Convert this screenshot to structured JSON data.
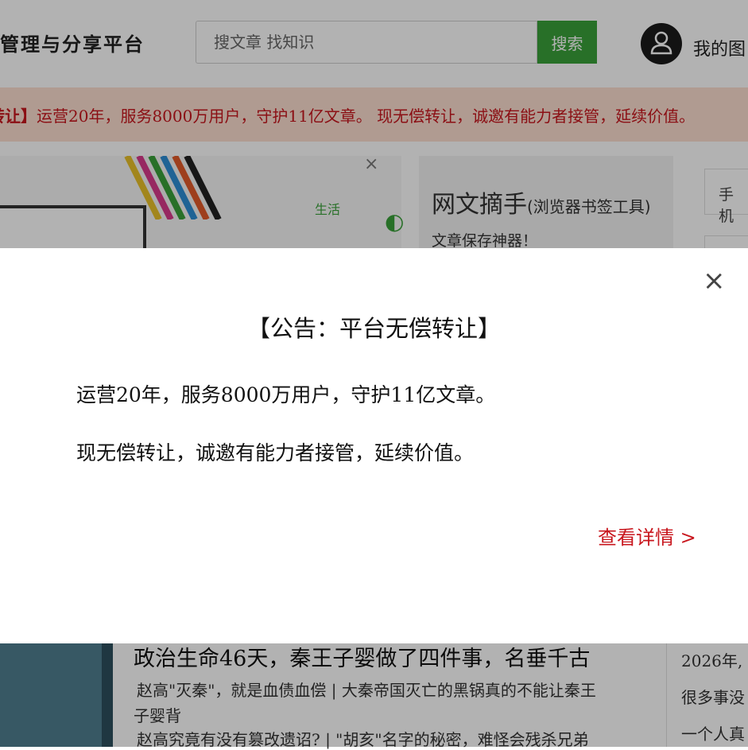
{
  "header": {
    "site_title": "管理与分享平台",
    "search_placeholder": "搜文章  找知识",
    "search_button": "搜索",
    "my_library": "我的图"
  },
  "banner": {
    "bold": "转让】",
    "text": "运营20年，服务8000万用户，守护11亿文章。 现无偿转让，诚邀有能力者接管，延续价值。"
  },
  "ad": {
    "close": "×",
    "label": "生活",
    "tool_title": "网文摘手",
    "tool_title_small": "(浏览器书签工具)",
    "tool_sub": "文章保存神器！",
    "phone": "手机"
  },
  "modal": {
    "close": "×",
    "title": "【公告：平台无偿转让】",
    "line1": "运营20年，服务8000万用户，守护11亿文章。",
    "line2": "现无偿转让，诚邀有能力者接管，延续价值。",
    "link": "查看详情 >"
  },
  "article": {
    "title": "政治生命46天，秦王子婴做了四件事，名垂千古",
    "sub1": "赵高\"灭秦\"，就是血债血偿 | 大秦帝国灭亡的黑锅真的不能让秦王",
    "sub2": "子婴背",
    "sub3": "赵高究竟有没有篡改遗诏? | \"胡亥\"名字的秘密，难怪会残杀兄弟"
  },
  "side": {
    "item1": "2026年,",
    "item2": "很多事没",
    "item3": "一个人真"
  },
  "colors": {
    "accent_green": "#3aa13a",
    "accent_red": "#c8161d",
    "banner_bg": "#fcded0"
  }
}
